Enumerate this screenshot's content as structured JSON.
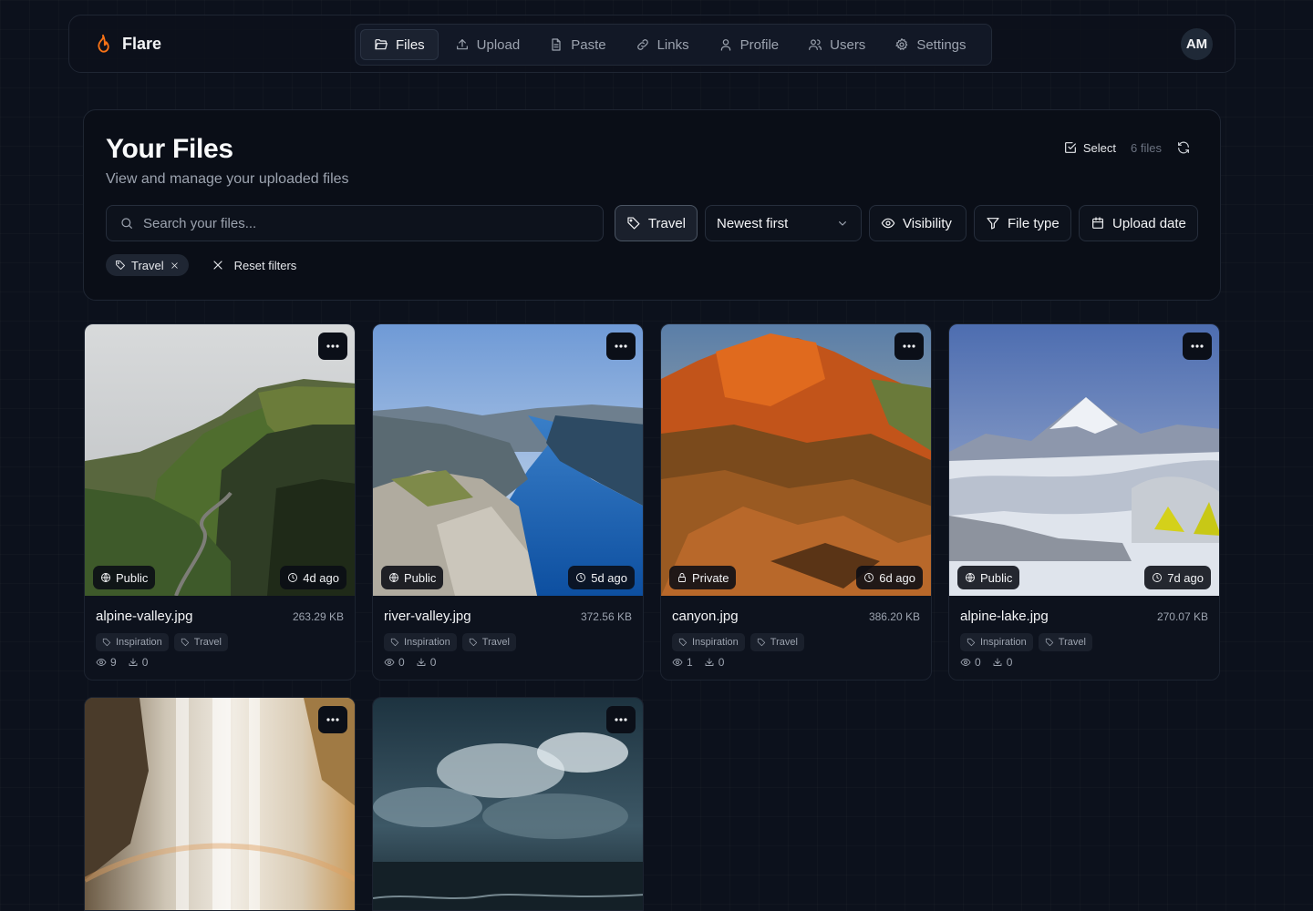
{
  "brand": {
    "name": "Flare",
    "accent": "#f97316"
  },
  "nav": {
    "items": [
      {
        "label": "Files",
        "icon": "folder-open-icon",
        "active": true
      },
      {
        "label": "Upload",
        "icon": "upload-icon"
      },
      {
        "label": "Paste",
        "icon": "file-text-icon"
      },
      {
        "label": "Links",
        "icon": "link-icon"
      },
      {
        "label": "Profile",
        "icon": "user-icon"
      },
      {
        "label": "Users",
        "icon": "users-icon"
      },
      {
        "label": "Settings",
        "icon": "gear-icon"
      }
    ]
  },
  "user": {
    "initials": "AM"
  },
  "page": {
    "title": "Your Files",
    "subtitle": "View and manage your uploaded files",
    "select_label": "Select",
    "file_count": "6 files"
  },
  "filters": {
    "search_placeholder": "Search your files...",
    "tag_label": "Travel",
    "sort_label": "Newest first",
    "visibility_label": "Visibility",
    "filetype_label": "File type",
    "uploaddate_label": "Upload date",
    "active_chip": "Travel",
    "reset_label": "Reset filters"
  },
  "files": [
    {
      "name": "alpine-valley.jpg",
      "size": "263.29 KB",
      "visibility": "Public",
      "age": "4d ago",
      "tags": [
        "Inspiration",
        "Travel"
      ],
      "views": "9",
      "downloads": "0"
    },
    {
      "name": "river-valley.jpg",
      "size": "372.56 KB",
      "visibility": "Public",
      "age": "5d ago",
      "tags": [
        "Inspiration",
        "Travel"
      ],
      "views": "0",
      "downloads": "0"
    },
    {
      "name": "canyon.jpg",
      "size": "386.20 KB",
      "visibility": "Private",
      "age": "6d ago",
      "tags": [
        "Inspiration",
        "Travel"
      ],
      "views": "1",
      "downloads": "0"
    },
    {
      "name": "alpine-lake.jpg",
      "size": "270.07 KB",
      "visibility": "Public",
      "age": "7d ago",
      "tags": [
        "Inspiration",
        "Travel"
      ],
      "views": "0",
      "downloads": "0"
    }
  ]
}
